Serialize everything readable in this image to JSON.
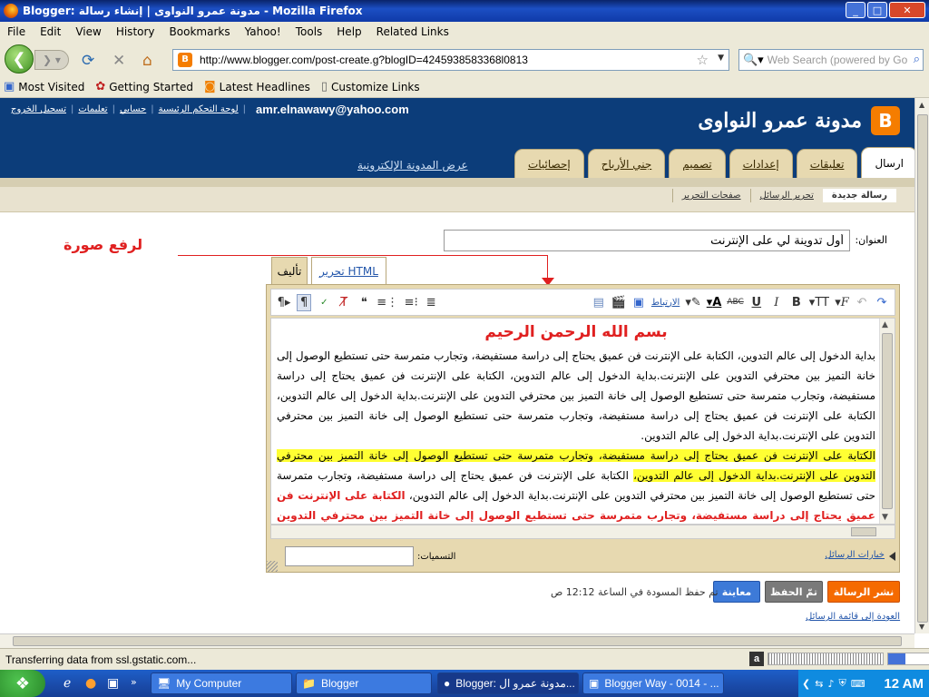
{
  "window": {
    "title": "Blogger: مدونة عمرو النواوى | إنشاء رسالة - Mozilla Firefox",
    "minimize": "_",
    "maximize": "□",
    "close": "✕"
  },
  "menu": [
    "File",
    "Edit",
    "View",
    "History",
    "Bookmarks",
    "Yahoo!",
    "Tools",
    "Help",
    "Related Links"
  ],
  "nav": {
    "url": "http://www.blogger.com/post-create.g?blogID=4245938583368l0813",
    "search_placeholder": "Web Search (powered by Go"
  },
  "bookmarks": [
    "Most Visited",
    "Getting Started",
    "Latest Headlines",
    "Customize Links"
  ],
  "blogger": {
    "blog_title": "مدونة عمرو النواوى",
    "email": "amr.elnawawy@yahoo.com",
    "user_links": [
      "لوحة التحكم الرئيسية",
      "حسابي",
      "تعليمات",
      "تسجيل الخروج"
    ],
    "view_blog": "عرض المدونة الإلكترونية",
    "tabs": [
      "ارسال",
      "تعليقات",
      "إعدادات",
      "تصميم",
      "جني الأرباح",
      "إحصائيات"
    ],
    "subtabs": [
      "رسالة جديدة",
      "تحرير الرسائل",
      "صفحات التحرير"
    ],
    "title_label": "العنوان:",
    "title_value": "أول تدوينة لي على الإنترنت",
    "annotation": "لرفع صورة",
    "mode_compose": "تأليف",
    "mode_html": "تحرير HTML",
    "toolbar": {
      "font": "F",
      "size": "T",
      "bold": "B",
      "italic": "I",
      "underline": "U",
      "strike": "ABC",
      "link": "الارتباط",
      "video_link": "الارتباط"
    },
    "post": {
      "heading": "بسم الله الرحمن الرحيم",
      "p1": "بداية الدخول إلى عالم التدوين، الكتابة على الإنترنت فن عميق يحتاج إلى دراسة مستفيضة، وتجارب متمرسة حتى تستطيع الوصول إلى خانة التميز بين محترفي التدوين على الإنترنت.بداية الدخول إلى عالم التدوين، الكتابة على الإنترنت فن عميق يحتاج إلى دراسة مستفيضة، وتجارب متمرسة حتى تستطيع الوصول إلى خانة التميز بين محترفي التدوين على الإنترنت.بداية الدخول إلى عالم التدوين، الكتابة على الإنترنت فن عميق يحتاج إلى دراسة مستفيضة، وتجارب متمرسة حتى تستطيع الوصول إلى خانة التميز بين محترفي التدوين على الإنترنت.بداية الدخول إلى عالم التدوين.",
      "p2_highlight": "الكتابة على الإنترنت فن عميق يحتاج إلى دراسة مستفيضة، وتجارب متمرسة حتى تستطيع الوصول إلى خانة التميز بين محترفي التدوين على الإنترنت.بداية الدخول إلى عالم التدوين،",
      "p2_rest": " الكتابة على الإنترنت فن عميق يحتاج إلى دراسة مستفيضة، وتجارب متمرسة حتى تستطيع الوصول إلى خانة التميز بين محترفي التدوين على الإنترنت.بداية الدخول إلى عالم التدوين، ",
      "p2_red": "الكتابة على الإنترنت فن عميق يحتاج إلى دراسة مستفيضة، وتجارب متمرسة حتى تستطيع الوصول إلى خانة التميز بين محترفي التدوين على الإنترنت."
    },
    "post_options": "خيارات الرسائل",
    "labels_label": "التسميات:",
    "publish": "نشر الرسالة",
    "saved": "تمّ الحفظ",
    "preview": "معاينة",
    "autosave_text": "تم حفظ المسودة في الساعة 12:12 ص",
    "back_link": "العودة إلى قائمة الرسائل"
  },
  "status": {
    "text": "Transferring data from ssl.gstatic.com..."
  },
  "taskbar": {
    "tasks": [
      "My Computer",
      "Blogger",
      "Blogger: مدونة عمرو ال...",
      "Blogger Way - 0014 - ..."
    ],
    "clock": "12 AM"
  }
}
